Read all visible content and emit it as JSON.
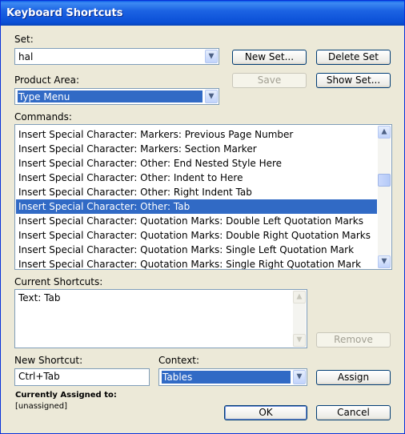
{
  "window": {
    "title": "Keyboard Shortcuts"
  },
  "set": {
    "label": "Set:",
    "value": "hal",
    "new_set_button": "New Set...",
    "delete_set_button": "Delete Set",
    "save_button": "Save",
    "show_set_button": "Show Set..."
  },
  "product_area": {
    "label": "Product Area:",
    "value": "Type Menu"
  },
  "commands": {
    "label": "Commands:",
    "items": [
      "Insert Special Character: Markers: Previous Page Number",
      "Insert Special Character: Markers: Section Marker",
      "Insert Special Character: Other: End Nested Style Here",
      "Insert Special Character: Other: Indent to Here",
      "Insert Special Character: Other: Right Indent Tab",
      "Insert Special Character: Other: Tab",
      "Insert Special Character: Quotation Marks: Double Left Quotation Marks",
      "Insert Special Character: Quotation Marks: Double Right Quotation Marks",
      "Insert Special Character: Quotation Marks: Single Left Quotation Mark",
      "Insert Special Character: Quotation Marks: Single Right Quotation Mark"
    ],
    "selected_index": 5
  },
  "current_shortcuts": {
    "label": "Current Shortcuts:",
    "items": [
      "Text: Tab"
    ],
    "remove_button": "Remove"
  },
  "new_shortcut": {
    "label": "New Shortcut:",
    "value": "Ctrl+Tab"
  },
  "context": {
    "label": "Context:",
    "value": "Tables",
    "assign_button": "Assign"
  },
  "assigned": {
    "label": "Currently Assigned to:",
    "value": "[unassigned]"
  },
  "footer": {
    "ok_button": "OK",
    "cancel_button": "Cancel"
  },
  "icons": {
    "dropdown": "chevron-down-icon",
    "scroll_up": "scroll-up-arrow-icon",
    "scroll_down": "scroll-down-arrow-icon"
  },
  "colors": {
    "title_bar": "#0a4fd6",
    "selection": "#316ac5",
    "dialog_face": "#ece9d8"
  }
}
